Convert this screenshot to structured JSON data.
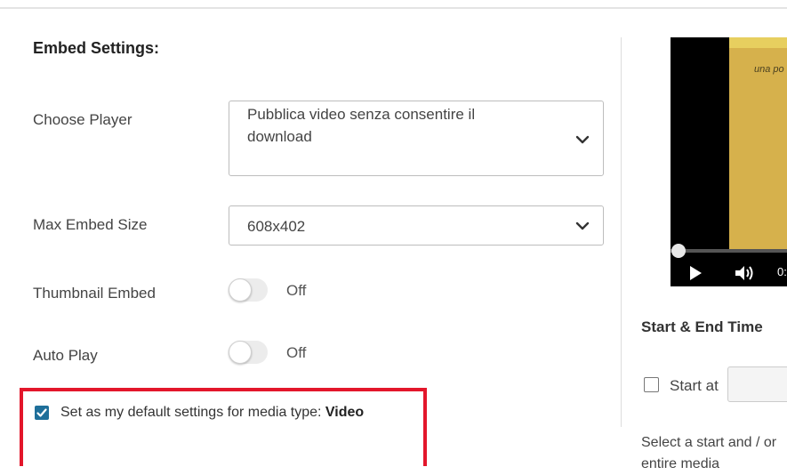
{
  "embed": {
    "title": "Embed Settings:",
    "player": {
      "label": "Choose Player",
      "value": "Pubblica video senza consentire il download"
    },
    "size": {
      "label": "Max Embed Size",
      "value": "608x402"
    },
    "thumbnail": {
      "label": "Thumbnail Embed",
      "state": "Off"
    },
    "autoplay": {
      "label": "Auto Play",
      "state": "Off"
    },
    "default": {
      "text": "Set as my default settings for media type: ",
      "media_type": "Video",
      "checked": true
    }
  },
  "preview": {
    "poster_text": "una po",
    "time": "0:"
  },
  "start_end": {
    "title": "Start & End Time",
    "start_label": "Start at",
    "help": "Select a start and / or entire media"
  },
  "colors": {
    "highlight": "#e3162b",
    "checkbox": "#1f6f9a"
  }
}
